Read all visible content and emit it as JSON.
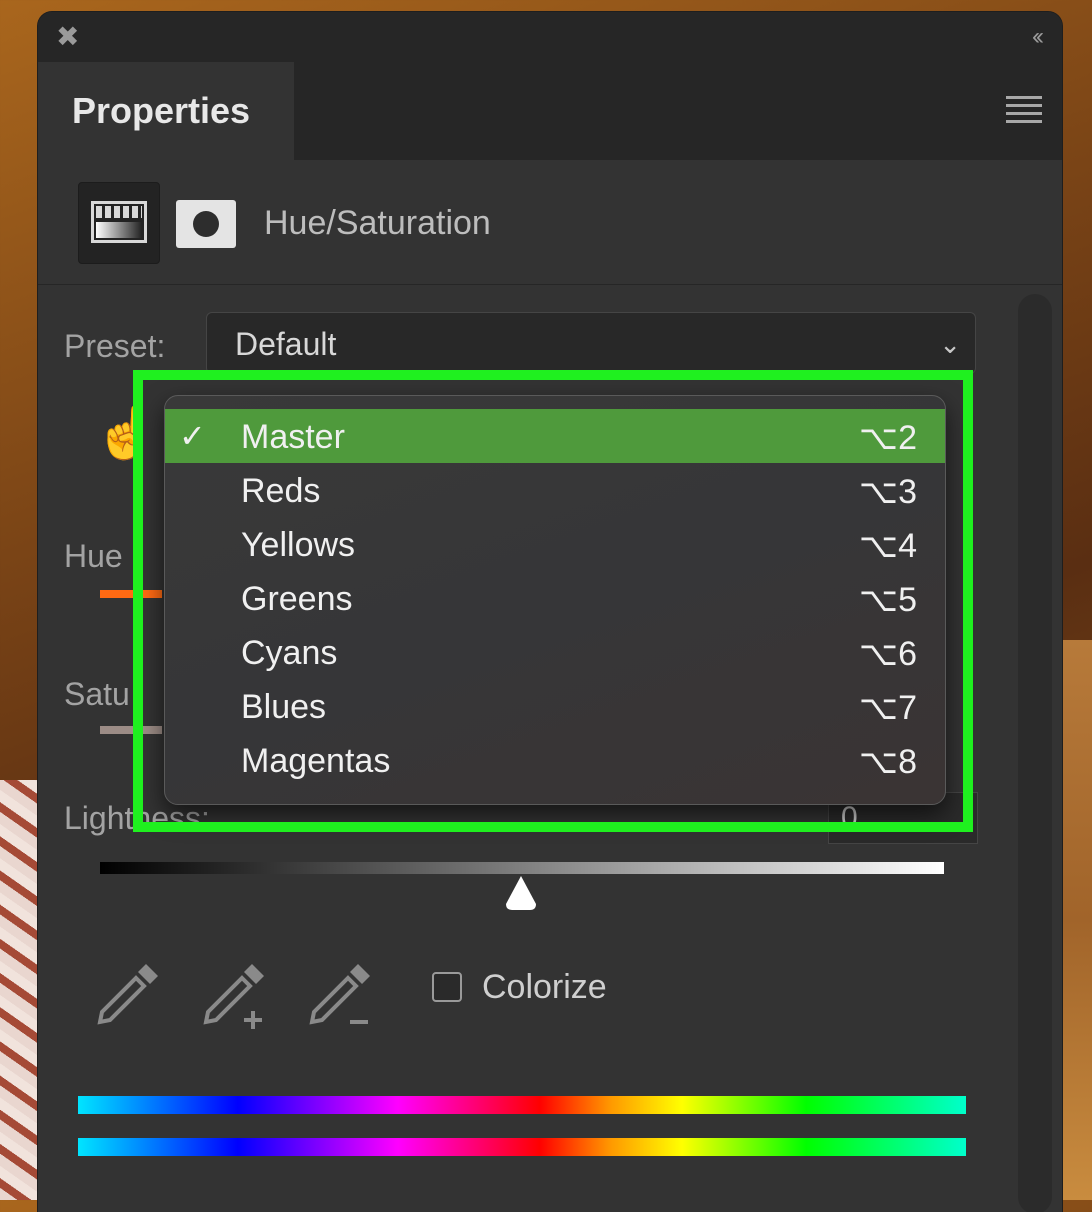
{
  "panel": {
    "close_icon": "close-x-icon",
    "collapse_icon": "double-chevron-left-icon",
    "tab_title": "Properties",
    "menu_icon": "hamburger-menu-icon"
  },
  "adjustment": {
    "title": "Hue/Saturation"
  },
  "preset": {
    "label": "Preset:",
    "value": "Default"
  },
  "sliders": {
    "hue_label": "Hue",
    "saturation_label": "Satu",
    "lightness_label": "Lightness:",
    "lightness_value": "0",
    "lightness_position": 0.5
  },
  "colorize": {
    "label": "Colorize",
    "checked": false
  },
  "dropdown": {
    "items": [
      {
        "label": "Master",
        "shortcut": "⌥2",
        "selected": true,
        "check": "✓"
      },
      {
        "label": "Reds",
        "shortcut": "⌥3",
        "selected": false,
        "check": ""
      },
      {
        "label": "Yellows",
        "shortcut": "⌥4",
        "selected": false,
        "check": ""
      },
      {
        "label": "Greens",
        "shortcut": "⌥5",
        "selected": false,
        "check": ""
      },
      {
        "label": "Cyans",
        "shortcut": "⌥6",
        "selected": false,
        "check": ""
      },
      {
        "label": "Blues",
        "shortcut": "⌥7",
        "selected": false,
        "check": ""
      },
      {
        "label": "Magentas",
        "shortcut": "⌥8",
        "selected": false,
        "check": ""
      }
    ]
  },
  "colors": {
    "selection_green": "#4f9a3c",
    "highlight_box": "#1ff01f"
  }
}
